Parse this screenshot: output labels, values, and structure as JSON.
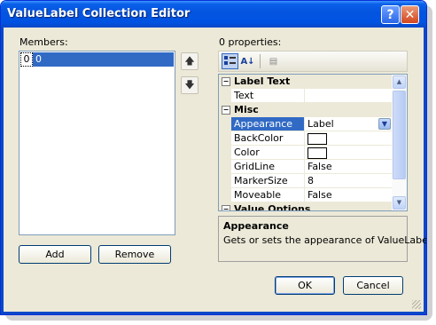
{
  "window": {
    "title": "ValueLabel Collection Editor",
    "help_glyph": "?",
    "close_glyph": "✕"
  },
  "members": {
    "label": "Members:",
    "items": [
      {
        "index": "0",
        "value": "0"
      }
    ],
    "move_up_glyph": "🡅",
    "move_down_glyph": "🡇",
    "add_label": "Add",
    "remove_label": "Remove"
  },
  "properties": {
    "label": "0 properties:",
    "toolbar": {
      "categorized_icon": "categorized-icon",
      "sort_glyph": "A↓",
      "pages_glyph": "▤"
    },
    "categories": [
      {
        "name": "Label Text",
        "toggle": "⊟",
        "rows": [
          {
            "name": "Text",
            "value": ""
          }
        ]
      },
      {
        "name": "Misc",
        "toggle": "⊟",
        "rows": [
          {
            "name": "Appearance",
            "value": "Label",
            "selected": true,
            "dropdown": true
          },
          {
            "name": "BackColor",
            "value": "",
            "swatch": "#ffffff"
          },
          {
            "name": "Color",
            "value": "",
            "swatch": "#ffffff"
          },
          {
            "name": "GridLine",
            "value": "False"
          },
          {
            "name": "MarkerSize",
            "value": "8"
          },
          {
            "name": "Moveable",
            "value": "False"
          }
        ]
      },
      {
        "name": "Value Options",
        "toggle": "⊟",
        "rows": []
      }
    ],
    "description": {
      "title": "Appearance",
      "text": "Gets or sets the appearance of ValueLabel."
    }
  },
  "footer": {
    "ok_label": "OK",
    "cancel_label": "Cancel"
  },
  "colors": {
    "title_bar": "#0454e0",
    "selection": "#316ac5",
    "dialog_face": "#ece9d8"
  }
}
